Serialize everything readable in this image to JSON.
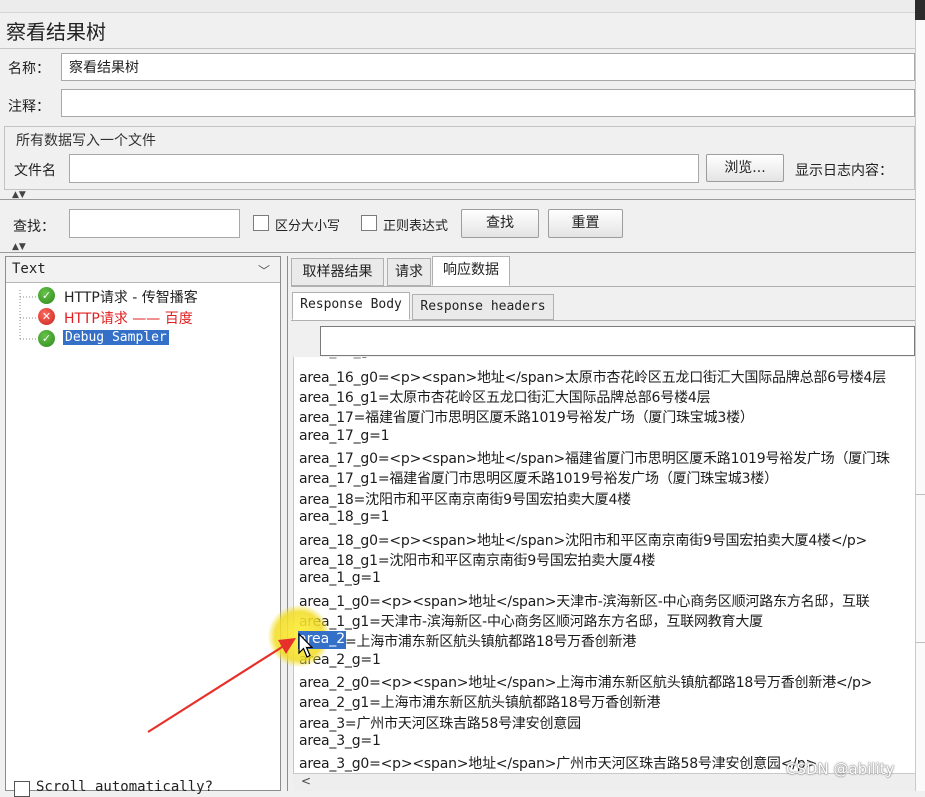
{
  "window": {
    "title": "察看结果树"
  },
  "form": {
    "name_label": "名称：",
    "name_value": "察看结果树",
    "comment_label": "注释：",
    "comment_value": "",
    "file_group_legend": "所有数据写入一个文件",
    "filename_label": "文件名",
    "filename_value": "",
    "browse_button": "浏览...",
    "log_content_label": "显示日志内容："
  },
  "search_bar": {
    "find_label": "查找：",
    "find_value": "",
    "case_sensitive_label": "区分大小写",
    "regex_label": "正则表达式",
    "find_button": "查找",
    "reset_button": "重置"
  },
  "results_tree": {
    "renderer_select": "Text",
    "items": [
      {
        "label": "HTTP请求 - 传智播客",
        "status": "success"
      },
      {
        "label": "HTTP请求 —— 百度",
        "status": "error"
      },
      {
        "label": "Debug Sampler",
        "status": "success",
        "selected": true
      }
    ],
    "scroll_automatically_label": "Scroll automatically?"
  },
  "detail_tabs": [
    "取样器结果",
    "请求",
    "响应数据"
  ],
  "active_detail_tab": "响应数据",
  "response_tabs": [
    "Response Body",
    "Response headers"
  ],
  "active_response_tab": "Response Body",
  "response_search_value": "",
  "response_body_lines": [
    "area_16_g0=<p><span>地址</span>太原市杏花岭区五龙口街汇大国际品牌总部6号楼4层",
    "area_16_g1=太原市杏花岭区五龙口街汇大国际品牌总部6号楼4层",
    "area_17=福建省厦门市思明区厦禾路1019号裕发广场（厦门珠宝城3楼）",
    "area_17_g=1",
    "area_17_g0=<p><span>地址</span>福建省厦门市思明区厦禾路1019号裕发广场（厦门珠",
    "area_17_g1=福建省厦门市思明区厦禾路1019号裕发广场（厦门珠宝城3楼）",
    "area_18=沈阳市和平区南京南街9号国宏拍卖大厦4楼",
    "area_18_g=1",
    "area_18_g0=<p><span>地址</span>沈阳市和平区南京南街9号国宏拍卖大厦4楼</p>",
    "area_18_g1=沈阳市和平区南京南街9号国宏拍卖大厦4楼",
    "area_1_g=1",
    "area_1_g0=<p><span>地址</span>天津市-滨海新区-中心商务区顺河路东方名邸，互联",
    "area_1_g1=天津市-滨海新区-中心商务区顺河路东方名邸，互联网教育大厦",
    "area_2=上海市浦东新区航头镇航都路18号万香创新港",
    "area_2_g=1",
    "area_2_g0=<p><span>地址</span>上海市浦东新区航头镇航都路18号万香创新港</p>",
    "area_2_g1=上海市浦东新区航头镇航都路18号万香创新港",
    "area_3=广州市天河区珠吉路58号津安创意园",
    "area_3_g=1",
    "area_3_g0=<p><span>地址</span>广州市天河区珠吉路58号津安创意园</p>"
  ],
  "highlighted_key": "area_2",
  "highlighted_rest": "=上海市浦东新区航头镇航都路18号万香创新港",
  "watermark": "CSDN @ability",
  "colors": {
    "selection": "#3470c8",
    "error_text": "#e02020",
    "highlight": "#f2dc23",
    "arrow": "#e8302a"
  }
}
